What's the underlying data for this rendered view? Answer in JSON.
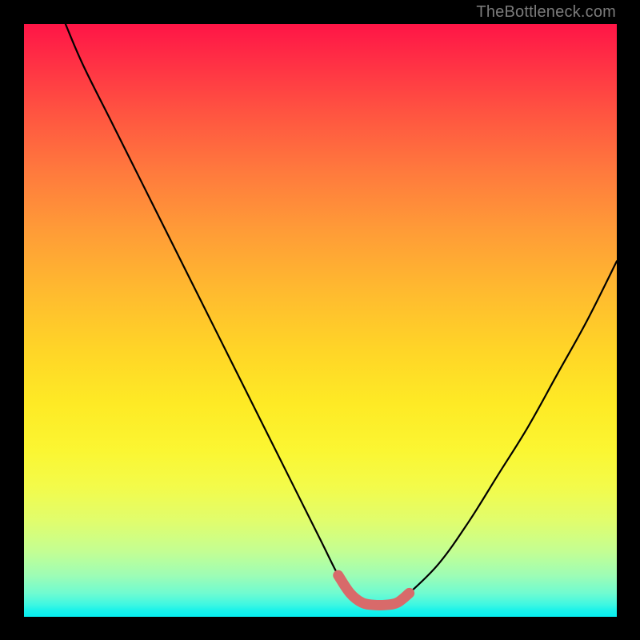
{
  "watermark": "TheBottleneck.com",
  "colors": {
    "background": "#000000",
    "curve_stroke": "#000000",
    "marker_stroke": "#d86a6a",
    "gradient_top": "#ff1546",
    "gradient_bottom": "#06eef0"
  },
  "chart_data": {
    "type": "line",
    "title": "",
    "xlabel": "",
    "ylabel": "",
    "xlim": [
      0,
      100
    ],
    "ylim": [
      0,
      100
    ],
    "series": [
      {
        "name": "bottleneck-curve",
        "x": [
          7,
          10,
          15,
          20,
          25,
          30,
          35,
          40,
          45,
          50,
          53,
          55,
          57,
          59,
          61,
          63,
          65,
          70,
          75,
          80,
          85,
          90,
          95,
          100
        ],
        "y": [
          100,
          93,
          83,
          73,
          63,
          53,
          43,
          33,
          23,
          13,
          7,
          4,
          2.4,
          2,
          2,
          2.4,
          4,
          9,
          16,
          24,
          32,
          41,
          50,
          60
        ]
      },
      {
        "name": "sweet-spot-marker",
        "x": [
          53,
          55,
          57,
          59,
          61,
          63,
          65
        ],
        "y": [
          7,
          4,
          2.4,
          2,
          2,
          2.4,
          4
        ]
      }
    ],
    "annotations": []
  }
}
